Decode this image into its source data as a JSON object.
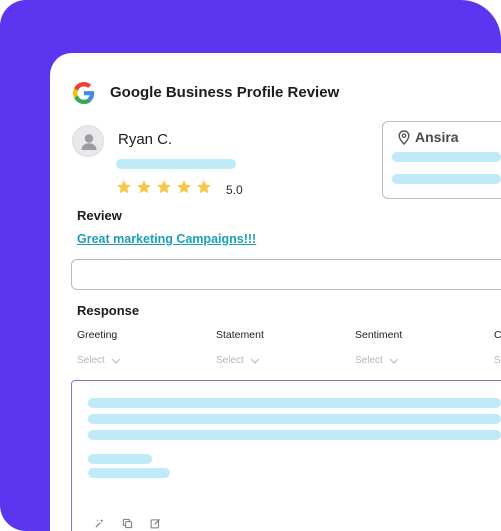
{
  "colors": {
    "brand_purple": "#5b35f0",
    "skeleton": "#bfeaf7",
    "link": "#1c9fb6",
    "star": "#f7c948",
    "editor_border": "#8a6ff0"
  },
  "header": {
    "logo_icon": "google-g-icon",
    "title": "Google Business Profile Review"
  },
  "reviewer": {
    "avatar_icon": "user-avatar-icon",
    "name": "Ryan C.",
    "stars": 5,
    "star_icon": "star-icon",
    "rating": "5.0"
  },
  "location": {
    "pin_icon": "location-pin-icon",
    "name": "Ansira"
  },
  "review": {
    "label": "Review",
    "title": "Great marketing Campaigns!!!"
  },
  "response": {
    "label": "Response",
    "columns": [
      {
        "label": "Greeting",
        "select": "Select"
      },
      {
        "label": "Statement",
        "select": "Select"
      },
      {
        "label": "Sentiment",
        "select": "Select"
      },
      {
        "label": "C",
        "select": "S"
      }
    ],
    "toolbar_icons": [
      "magic-wand-icon",
      "copy-icon",
      "edit-icon"
    ]
  }
}
